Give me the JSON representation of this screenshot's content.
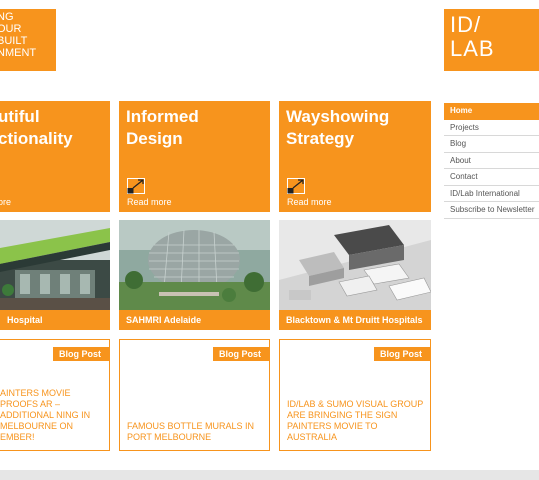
{
  "header": {
    "logo_left_lines": [
      "NG",
      "OUR",
      "BUILT",
      "NMENT"
    ],
    "logo_right_lines": [
      "ID/",
      "LAB"
    ]
  },
  "tiles": [
    {
      "line1": "utiful",
      "line2": "ctionality",
      "link": "ore"
    },
    {
      "line1": "Informed",
      "line2": "Design",
      "link": "Read more"
    },
    {
      "line1": "Wayshowing",
      "line2": "Strategy",
      "link": "Read more"
    }
  ],
  "projects": [
    {
      "caption": "Hospital"
    },
    {
      "caption": "SAHMRI Adelaide"
    },
    {
      "caption": "Blacktown & Mt Druitt Hospitals"
    }
  ],
  "posts": [
    {
      "badge": "Blog Post",
      "title": "AINTERS MOVIE PROOFS AR – ADDITIONAL NING IN MELBOURNE ON EMBER!"
    },
    {
      "badge": "Blog Post",
      "title": "FAMOUS BOTTLE MURALS IN PORT MELBOURNE"
    },
    {
      "badge": "Blog Post",
      "title": "ID/LAB & SUMO VISUAL GROUP ARE BRINGING THE SIGN PAINTERS MOVIE TO AUSTRALIA"
    }
  ],
  "nav": {
    "items": [
      "Home",
      "Projects",
      "Blog",
      "About",
      "Contact",
      "ID/Lab International",
      "Subscribe to Newsletter"
    ],
    "active": "Home"
  },
  "colors": {
    "accent": "#f7941d",
    "footer": "#e6e6e6"
  }
}
